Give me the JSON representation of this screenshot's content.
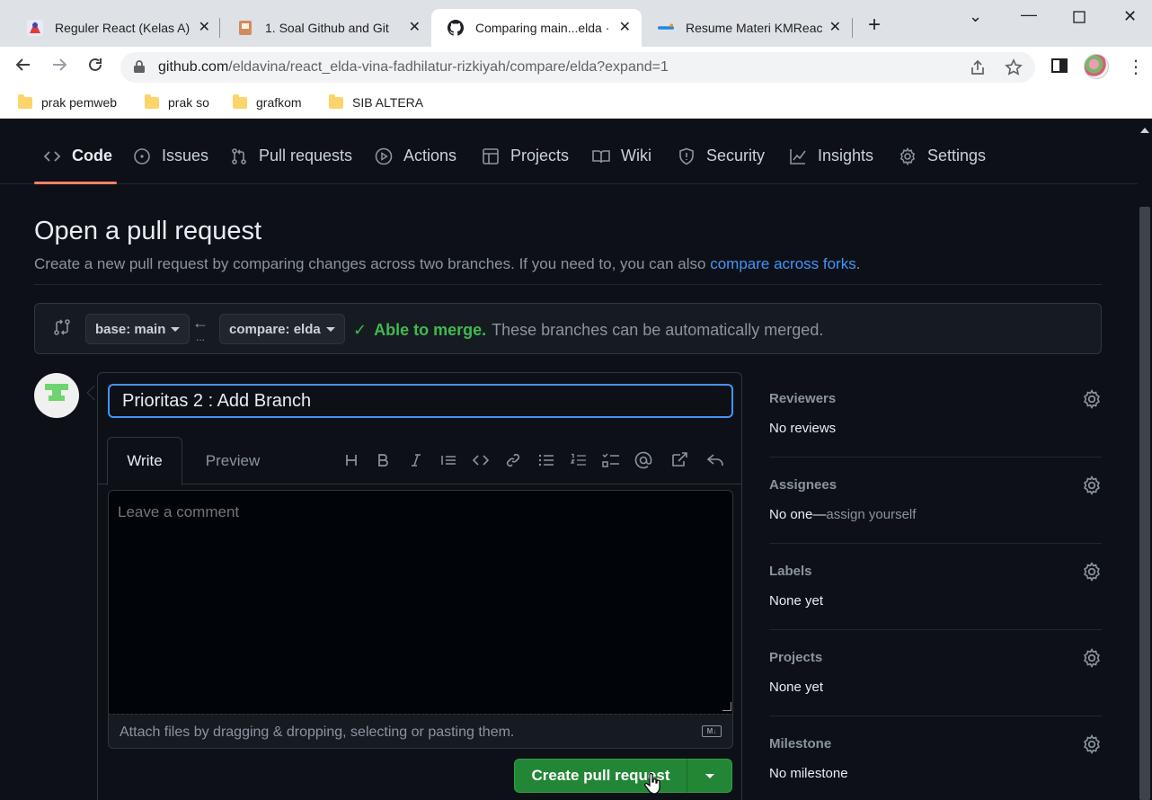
{
  "browser": {
    "tabs": [
      {
        "title": "Reguler React (Kelas A)",
        "active": false
      },
      {
        "title": "1. Soal Github and Git",
        "active": false
      },
      {
        "title": "Comparing main...elda · eldavina/react_elda",
        "active": true
      },
      {
        "title": "Resume Materi KMReact",
        "active": false
      }
    ],
    "url_host": "github.com",
    "url_path": "/eldavina/react_elda-vina-fadhilatur-rizkiyah/compare/elda?expand=1",
    "bookmarks": [
      "prak pemweb",
      "prak so",
      "grafkom",
      "SIB ALTERA"
    ]
  },
  "repo_nav": {
    "items": [
      {
        "label": "Code",
        "icon": "code-icon",
        "selected": true
      },
      {
        "label": "Issues",
        "icon": "issue-icon",
        "selected": false
      },
      {
        "label": "Pull requests",
        "icon": "pull-request-icon",
        "selected": false
      },
      {
        "label": "Actions",
        "icon": "play-icon",
        "selected": false
      },
      {
        "label": "Projects",
        "icon": "table-icon",
        "selected": false
      },
      {
        "label": "Wiki",
        "icon": "book-icon",
        "selected": false
      },
      {
        "label": "Security",
        "icon": "shield-icon",
        "selected": false
      },
      {
        "label": "Insights",
        "icon": "graph-icon",
        "selected": false
      },
      {
        "label": "Settings",
        "icon": "gear-icon",
        "selected": false
      }
    ]
  },
  "header": {
    "title": "Open a pull request",
    "subtitle_prefix": "Create a new pull request by comparing changes across two branches. If you need to, you can also ",
    "subtitle_link": "compare across forks",
    "subtitle_suffix": "."
  },
  "range": {
    "base_label": "base: main",
    "compare_label": "compare: elda",
    "arrow": "←",
    "dots": "...",
    "merge_ok": "Able to merge.",
    "merge_text": "These branches can be automatically merged."
  },
  "composer": {
    "title_value": "Prioritas 2 : Add Branch",
    "tab_write": "Write",
    "tab_preview": "Preview",
    "comment_placeholder": "Leave a comment",
    "attach_text": "Attach files by dragging & dropping, selecting or pasting them.",
    "markdown_badge": "M↓",
    "toolbar": [
      "heading-icon",
      "bold-icon",
      "italic-icon",
      "quote-icon",
      "code-icon",
      "link-icon",
      "unordered-list-icon",
      "ordered-list-icon",
      "task-list-icon",
      "mention-icon",
      "cross-reference-icon",
      "reply-icon"
    ],
    "submit_label": "Create pull request"
  },
  "sidebar": {
    "reviewers": {
      "label": "Reviewers",
      "value": "No reviews"
    },
    "assignees": {
      "label": "Assignees",
      "value": "No one—",
      "value_link": "assign yourself"
    },
    "labels": {
      "label": "Labels",
      "value": "None yet"
    },
    "projects": {
      "label": "Projects",
      "value": "None yet"
    },
    "milestone": {
      "label": "Milestone",
      "value": "No milestone"
    }
  },
  "colors": {
    "accent_link": "#4493f8",
    "merge_green": "#3fb950",
    "button_green": "#238636",
    "tab_underline": "#f78166"
  }
}
